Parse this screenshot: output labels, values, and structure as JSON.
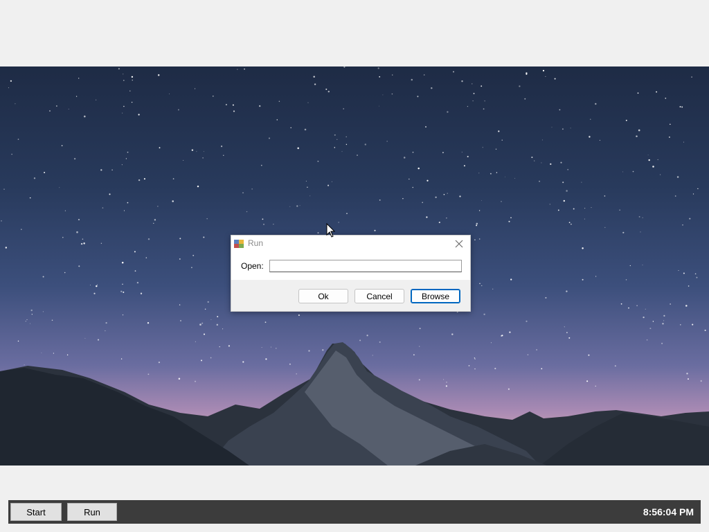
{
  "desktop": {
    "wallpaper": "starry-sky-mountain"
  },
  "dialog": {
    "title": "Run",
    "icon": "run-app-icon",
    "open_label": "Open:",
    "open_value": "",
    "buttons": {
      "ok": "Ok",
      "cancel": "Cancel",
      "browse": "Browse"
    }
  },
  "taskbar": {
    "start_label": "Start",
    "run_label": "Run",
    "clock": "8:56:04 PM"
  },
  "colors": {
    "taskbar": "#3c3c3c",
    "accent": "#0067c0",
    "background": "#f0f0f0"
  }
}
